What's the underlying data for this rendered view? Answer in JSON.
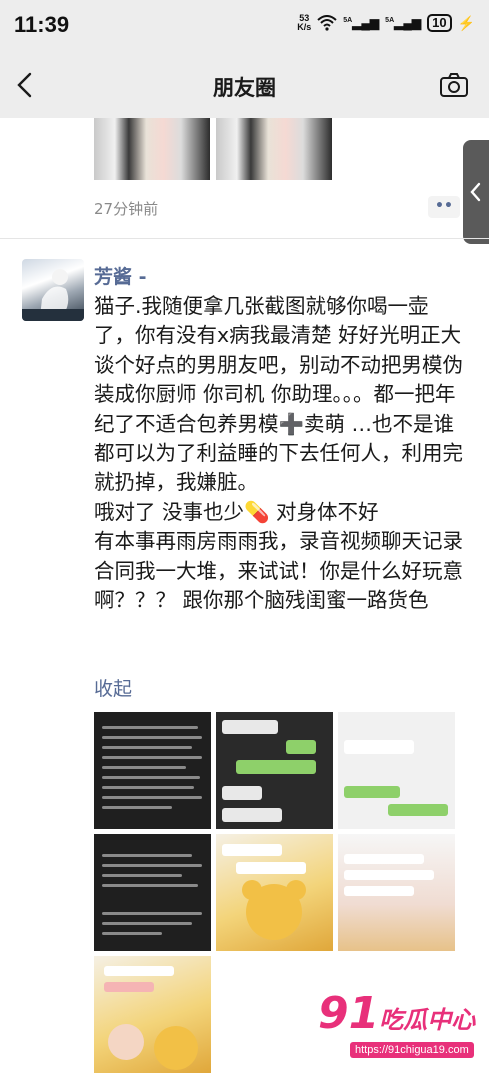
{
  "status_bar": {
    "time": "11:39",
    "net_speed_value": "53",
    "net_speed_unit": "K/s",
    "signal_1": "5A",
    "signal_2": "5A",
    "battery": "10",
    "icons": [
      "wifi-icon",
      "signal-icon",
      "signal-icon",
      "battery-icon",
      "charging-icon"
    ]
  },
  "nav": {
    "title": "朋友圈",
    "back_icon": "chevron-left-icon",
    "camera_icon": "camera-icon"
  },
  "previous_post": {
    "time_ago": "27分钟前",
    "more_button": "••"
  },
  "post": {
    "author": "芳酱 -",
    "text": "猫子.我随便拿几张截图就够你喝一壶了，你有没有x病我最清楚 好好光明正大谈个好点的男朋友吧，别动不动把男模伪装成你厨师 你司机 你助理。。。都一把年纪了不适合包养男模➕卖萌 …也不是谁都可以为了利益睡的下去任何人，利用完就扔掉，我嫌脏。\n哦对了 没事也少💊 对身体不好\n有本事再雨房雨雨我，录音视频聊天记录合同我一大堆，来试试！你是什么好玩意啊？？？ 跟你那个脑残闺蜜一路货色",
    "collapse_label": "收起",
    "image_count": 10
  },
  "watermark": {
    "logo_number": "91",
    "logo_text": "吃瓜中心",
    "url": "https://91chigua19.com"
  },
  "colors": {
    "link": "#576b95",
    "nav_bg": "#ededed",
    "watermark": "#e8307a"
  }
}
